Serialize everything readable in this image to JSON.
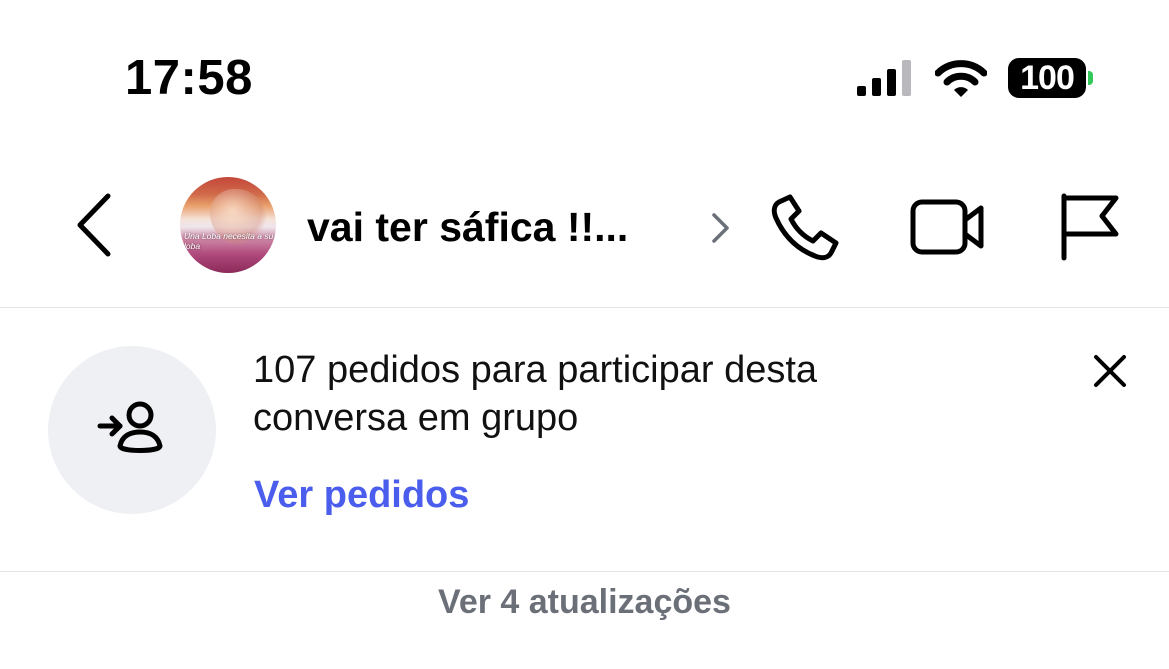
{
  "status_bar": {
    "time": "17:58",
    "battery_level": "100",
    "icons": [
      "cellular-signal-icon",
      "wifi-icon",
      "battery-icon"
    ]
  },
  "header": {
    "back_icon": "chevron-left-icon",
    "title": "vai ter sáfica !!...",
    "title_chevron_icon": "chevron-right-icon",
    "avatar_caption": "Una Loba necesita a su loba",
    "actions": [
      "phone-icon",
      "video-camera-icon",
      "flag-icon"
    ]
  },
  "request_banner": {
    "icon": "person-arrow-in-icon",
    "message": "107 pedidos para participar desta conversa em grupo",
    "link_label": "Ver pedidos",
    "dismiss_icon": "close-icon"
  },
  "updates": {
    "label": "Ver 4 atualizações"
  },
  "colors": {
    "link": "#4a5ded",
    "muted_text": "#6b6f78",
    "icon_bg": "#eef0f3",
    "divider": "#e3e4e8",
    "battery_charging": "#34c759"
  }
}
